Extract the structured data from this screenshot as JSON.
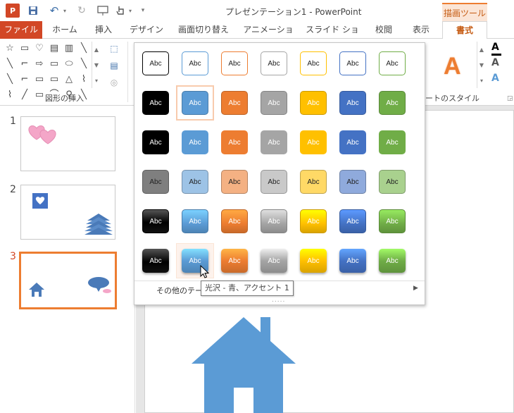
{
  "titlebar": {
    "app_icon": "P",
    "title": "プレゼンテーション1 - PowerPoint",
    "context_group": "描画ツール",
    "qat_icons": [
      "powerpoint-logo-icon",
      "save-icon",
      "undo-icon",
      "redo-icon",
      "present-icon",
      "touch-mode-icon",
      "customize-qat-icon"
    ]
  },
  "tabs": [
    {
      "label": "ファイル"
    },
    {
      "label": "ホーム"
    },
    {
      "label": "挿入"
    },
    {
      "label": "デザイン"
    },
    {
      "label": "画面切り替え"
    },
    {
      "label": "アニメーション"
    },
    {
      "label": "スライド ショー"
    },
    {
      "label": "校閲"
    },
    {
      "label": "表示"
    },
    {
      "label": "書式"
    }
  ],
  "ribbon": {
    "insert_shapes_label": "図形の挿入",
    "shape_styles_label_fragment": "ートのスタイル",
    "wordart_letter": "A",
    "shape_glyphs": [
      "☆",
      "▭",
      "♡",
      "▤",
      "▥",
      "╲",
      "╲",
      "⌐",
      "⇨",
      "▭",
      "⬭",
      "╲",
      "╲",
      "⌐",
      "▭",
      "▭",
      "△",
      "⌇",
      "⌇",
      "╱",
      "▭",
      "⌒",
      "⚲",
      "╲"
    ],
    "text_format_glyphs": [
      "A",
      "A",
      "A"
    ]
  },
  "colors": {
    "accent": "#d24726",
    "context": "#ed7d31",
    "selection_frame": "#f8cbad"
  },
  "slides": [
    {
      "number": "1"
    },
    {
      "number": "2"
    },
    {
      "number": "3"
    }
  ],
  "gallery": {
    "swatch_text": "Abc",
    "rows": [
      {
        "style": "outline",
        "colors": [
          "#000000",
          "#5b9bd5",
          "#ed7d31",
          "#a5a5a5",
          "#ffc000",
          "#4472c4",
          "#70ad47"
        ]
      },
      {
        "style": "fill",
        "colors": [
          "#000000",
          "#5b9bd5",
          "#ed7d31",
          "#a5a5a5",
          "#ffc000",
          "#4472c4",
          "#70ad47"
        ]
      },
      {
        "style": "fill-flat",
        "colors": [
          "#000000",
          "#5b9bd5",
          "#ed7d31",
          "#a5a5a5",
          "#ffc000",
          "#4472c4",
          "#70ad47"
        ]
      },
      {
        "style": "light",
        "colors": [
          "#7f7f7f",
          "#9dc3e6",
          "#f4b183",
          "#c9c9c9",
          "#ffd966",
          "#8faadc",
          "#a9d18e"
        ]
      },
      {
        "style": "gradient",
        "colors": [
          "#000000",
          "#5b9bd5",
          "#ed7d31",
          "#a5a5a5",
          "#ffc000",
          "#4472c4",
          "#70ad47"
        ]
      },
      {
        "style": "glossy",
        "colors": [
          "#000000",
          "#5b9bd5",
          "#ed7d31",
          "#a5a5a5",
          "#ffc000",
          "#4472c4",
          "#70ad47"
        ]
      }
    ],
    "selected": {
      "row": 1,
      "col": 1
    },
    "hovered": {
      "row": 5,
      "col": 1
    },
    "other_themes_label": "その他のテー",
    "grip": "....."
  },
  "tooltip": {
    "text": "光沢 - 青、アクセント 1"
  }
}
